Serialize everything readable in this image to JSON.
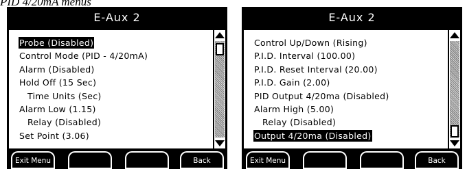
{
  "caption": "PID 4/20mA menus",
  "screens": [
    {
      "title": "E-Aux 2",
      "items": [
        {
          "label": "Probe (Disabled)",
          "selected": true,
          "indent": false
        },
        {
          "label": "Control Mode (PID - 4/20mA)",
          "selected": false,
          "indent": false
        },
        {
          "label": "Alarm (Disabled)",
          "selected": false,
          "indent": false
        },
        {
          "label": "Hold Off (15 Sec)",
          "selected": false,
          "indent": false
        },
        {
          "label": "Time Units (Sec)",
          "selected": false,
          "indent": true
        },
        {
          "label": "Alarm Low (1.15)",
          "selected": false,
          "indent": false
        },
        {
          "label": "Relay (Disabled)",
          "selected": false,
          "indent": true
        },
        {
          "label": "Set Point (3.06)",
          "selected": false,
          "indent": false
        }
      ],
      "scroll_position": "top",
      "softkeys": [
        "Exit Menu",
        "",
        "",
        "Back"
      ]
    },
    {
      "title": "E-Aux 2",
      "items": [
        {
          "label": "Control Up/Down (Rising)",
          "selected": false,
          "indent": false
        },
        {
          "label": "P.I.D. Interval (100.00)",
          "selected": false,
          "indent": false
        },
        {
          "label": "P.I.D. Reset Interval (20.00)",
          "selected": false,
          "indent": false
        },
        {
          "label": "P.I.D. Gain (2.00)",
          "selected": false,
          "indent": false
        },
        {
          "label": "PID Output 4/20ma (Disabled)",
          "selected": false,
          "indent": false
        },
        {
          "label": "Alarm High (5.00)",
          "selected": false,
          "indent": false
        },
        {
          "label": "Relay (Disabled)",
          "selected": false,
          "indent": true
        },
        {
          "label": "Output 4/20ma (Disabled)",
          "selected": true,
          "indent": false
        }
      ],
      "scroll_position": "bottom",
      "softkeys": [
        "Exit Menu",
        "",
        "",
        "Back"
      ]
    }
  ]
}
